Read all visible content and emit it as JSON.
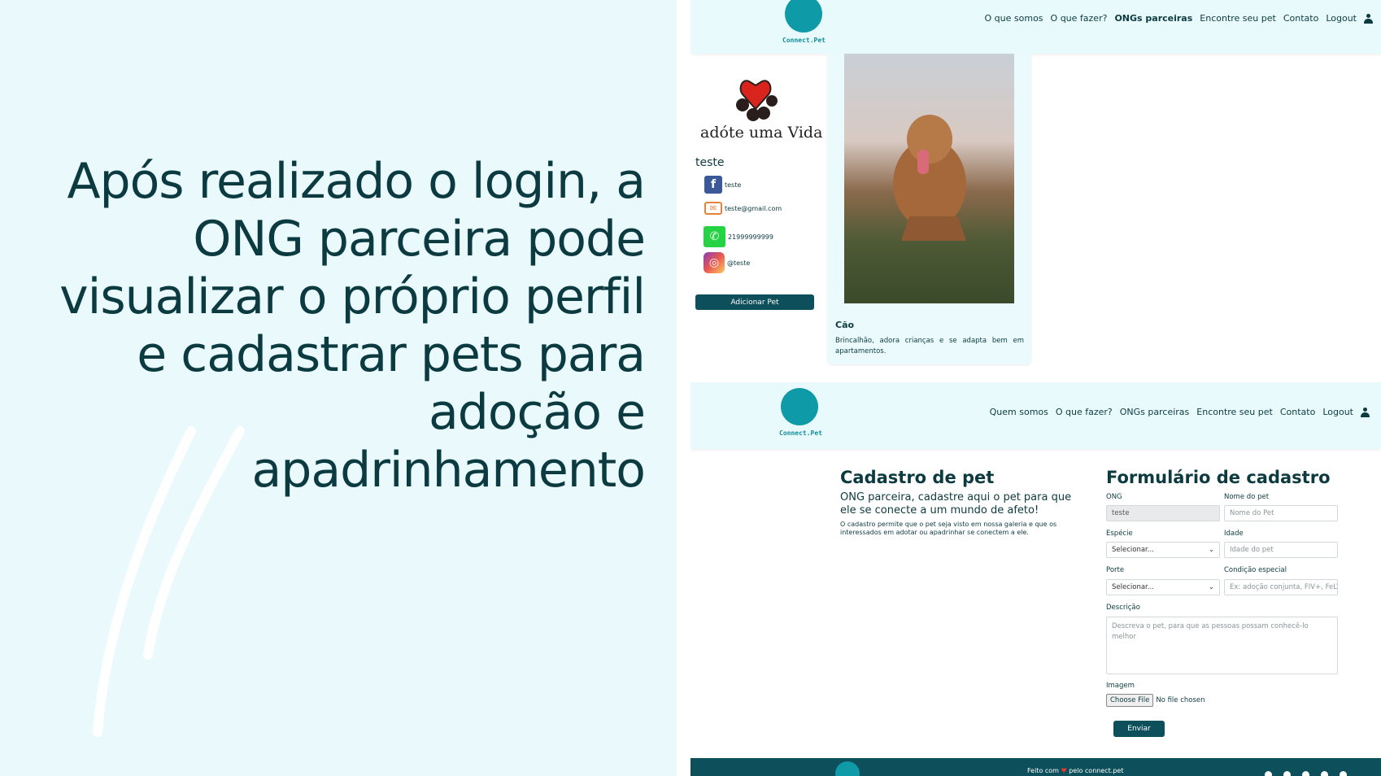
{
  "headline": "Após realizado o login, a ONG parceira pode visualizar o próprio perfil e cadastrar pets para adoção e apadrinhamento",
  "colors": {
    "dark": "#0b3b40",
    "accent": "#0f9aa8",
    "footer": "#0d4f5a",
    "header_bg": "#e9fafd"
  },
  "profile_page": {
    "logo_text": "Connect.Pet",
    "nav": [
      "O que somos",
      "O que fazer?",
      "ONGs parceiras",
      "Encontre seu pet",
      "Contato",
      "Logout"
    ],
    "active_nav": "ONGs parceiras",
    "ong_logo_text": "adóte uma Vida",
    "ong_name": "teste",
    "contacts": {
      "facebook": "teste",
      "email": "teste@gmail.com",
      "whatsapp": "21999999999",
      "instagram": "@teste"
    },
    "add_pet_label": "Adicionar Pet",
    "pet": {
      "species": "Cão",
      "description": "Brincalhão, adora crianças e se adapta bem em apartamentos."
    }
  },
  "form_page": {
    "logo_text": "Connect.Pet",
    "nav": [
      "Quem somos",
      "O que fazer?",
      "ONGs parceiras",
      "Encontre seu pet",
      "Contato",
      "Logout"
    ],
    "title": "Cadastro de pet",
    "subtitle": "ONG parceira, cadastre aqui o pet para que ele se conecte a um mundo de afeto!",
    "intro": "O cadastro permite que o pet seja visto em nossa galeria e que os interessados em adotar ou apadrinhar se conectem a ele.",
    "form_title": "Formulário de cadastro",
    "fields": {
      "ong": {
        "label": "ONG",
        "value": "teste"
      },
      "name": {
        "label": "Nome do pet",
        "placeholder": "Nome do Pet"
      },
      "species": {
        "label": "Espécie",
        "value": "Selecionar..."
      },
      "age": {
        "label": "Idade",
        "placeholder": "Idade do pet"
      },
      "size": {
        "label": "Porte",
        "value": "Selecionar..."
      },
      "special": {
        "label": "Condição especial",
        "placeholder": "Ex: adoção conjunta, FIV+, FeLV"
      },
      "description": {
        "label": "Descrição",
        "placeholder": "Descreva o pet, para que as pessoas possam conhecê-lo melhor"
      },
      "image": {
        "label": "Imagem",
        "button": "Choose File",
        "status": "No file chosen"
      }
    },
    "submit_label": "Enviar",
    "footer_text_a": "Feito com",
    "footer_text_b": "pelo connect.pet"
  }
}
